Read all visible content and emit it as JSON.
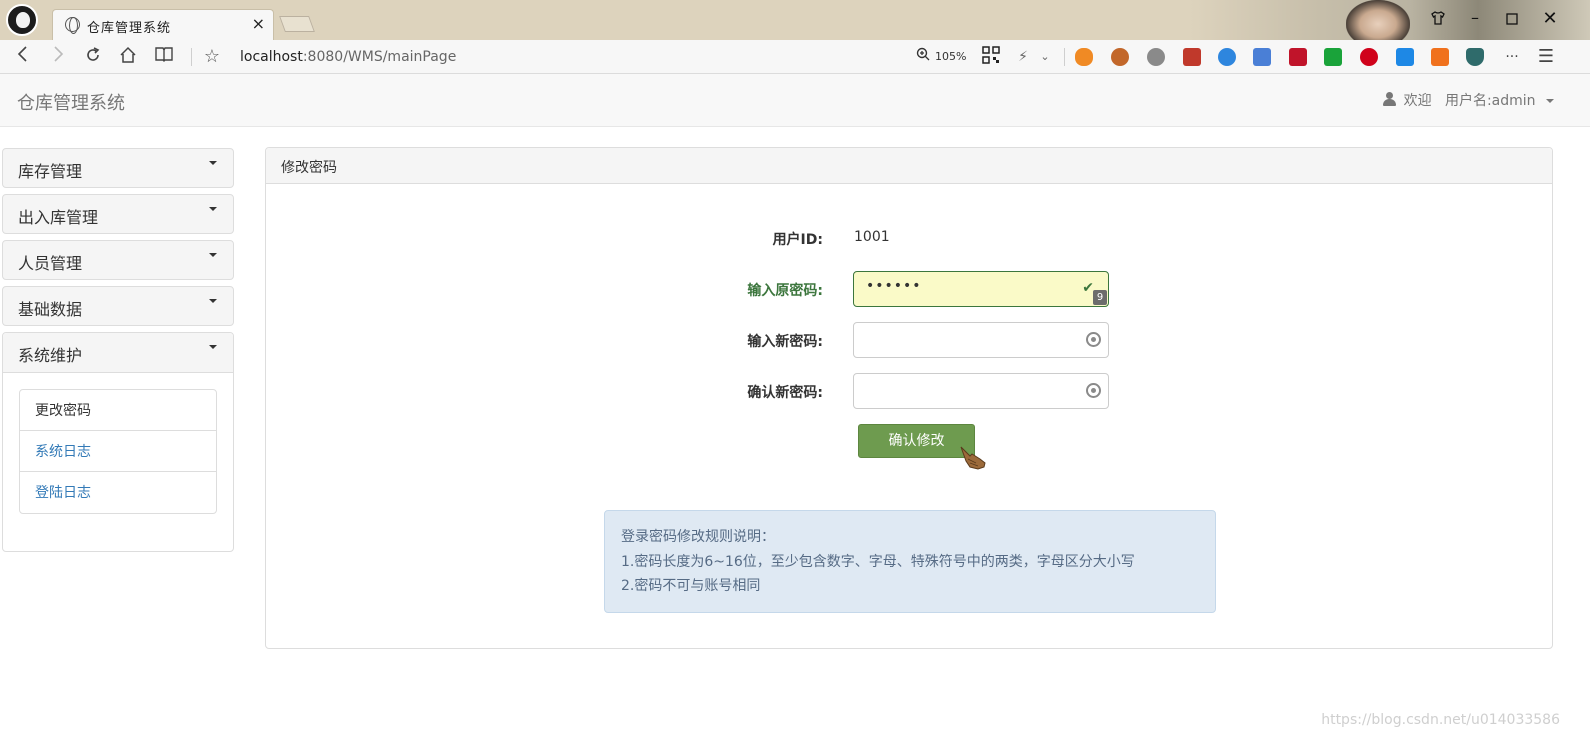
{
  "browser": {
    "tab_title": "仓库管理系统",
    "tab_close": "×",
    "url_host": "localhost",
    "url_rest": ":8080/WMS/mainPage",
    "zoom": "105%",
    "more": "···",
    "menu": "☰"
  },
  "navbar": {
    "brand": "仓库管理系统",
    "welcome": "欢迎",
    "username": "用户名:admin"
  },
  "sidebar": {
    "sections": [
      {
        "label": "库存管理"
      },
      {
        "label": "出入库管理"
      },
      {
        "label": "人员管理"
      },
      {
        "label": "基础数据"
      },
      {
        "label": "系统维护"
      }
    ],
    "sub_items": [
      {
        "label": "更改密码"
      },
      {
        "label": "系统日志"
      },
      {
        "label": "登陆日志"
      }
    ]
  },
  "panel": {
    "title": "修改密码",
    "user_id_label": "用户ID:",
    "user_id_value": "1001",
    "old_password_label": "输入原密码:",
    "old_password_value": "••••••",
    "new_password_label": "输入新密码:",
    "confirm_password_label": "确认新密码:",
    "submit_label": "确认修改",
    "badge": "9",
    "rules": [
      "登录密码修改规则说明：",
      "1.密码长度为6~16位，至少包含数字、字母、特殊符号中的两类，字母区分大小写",
      "2.密码不可与账号相同"
    ]
  },
  "watermark": "https://blog.csdn.net/u014033586",
  "colors": {
    "accent_green": "#6e9b4f",
    "link_blue": "#337ab7",
    "alert_bg": "#dfe9f3"
  }
}
